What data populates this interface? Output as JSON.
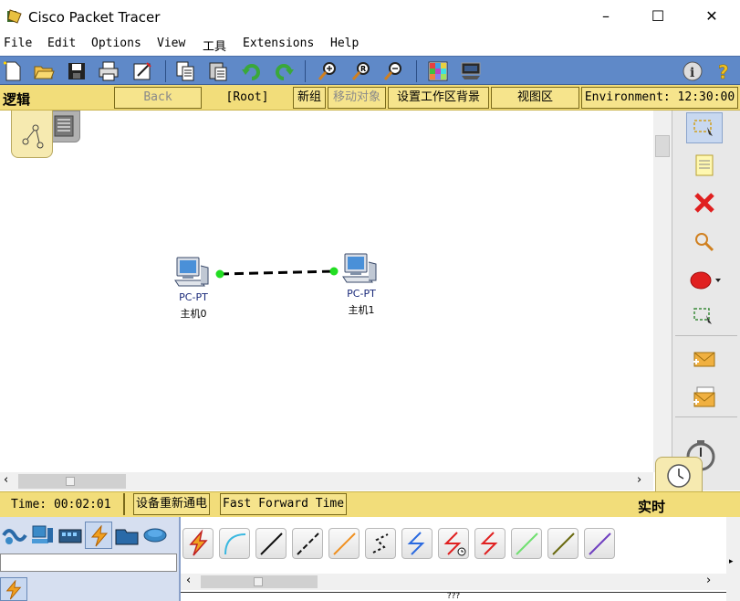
{
  "window": {
    "title": "Cisco Packet Tracer",
    "minimize": "–",
    "maximize": "☐",
    "close": "✕"
  },
  "menu": [
    "File",
    "Edit",
    "Options",
    "View",
    "工具",
    "Extensions",
    "Help"
  ],
  "logic_bar": {
    "label": "逻辑",
    "back": "Back",
    "root": "[Root]",
    "new_cluster": "新组",
    "move_object": "移动对象",
    "set_background": "设置工作区背景",
    "viewport": "视图区",
    "environment": "Environment: 12:30:00"
  },
  "nodes": [
    {
      "type": "PC-PT",
      "name": "主机0"
    },
    {
      "type": "PC-PT",
      "name": "主机1"
    }
  ],
  "time_bar": {
    "time": "Time: 00:02:01",
    "power_cycle": "设备重新通电",
    "fast_forward": "Fast Forward Time",
    "realtime": "实时"
  },
  "bottom": {
    "device_name_value": "",
    "bottom_text": "???"
  },
  "colors": {
    "toolbar": "#5f89c8",
    "logic_bar": "#f2dd7a",
    "link_dot": "#22dd22",
    "delete_red": "#e02020"
  }
}
